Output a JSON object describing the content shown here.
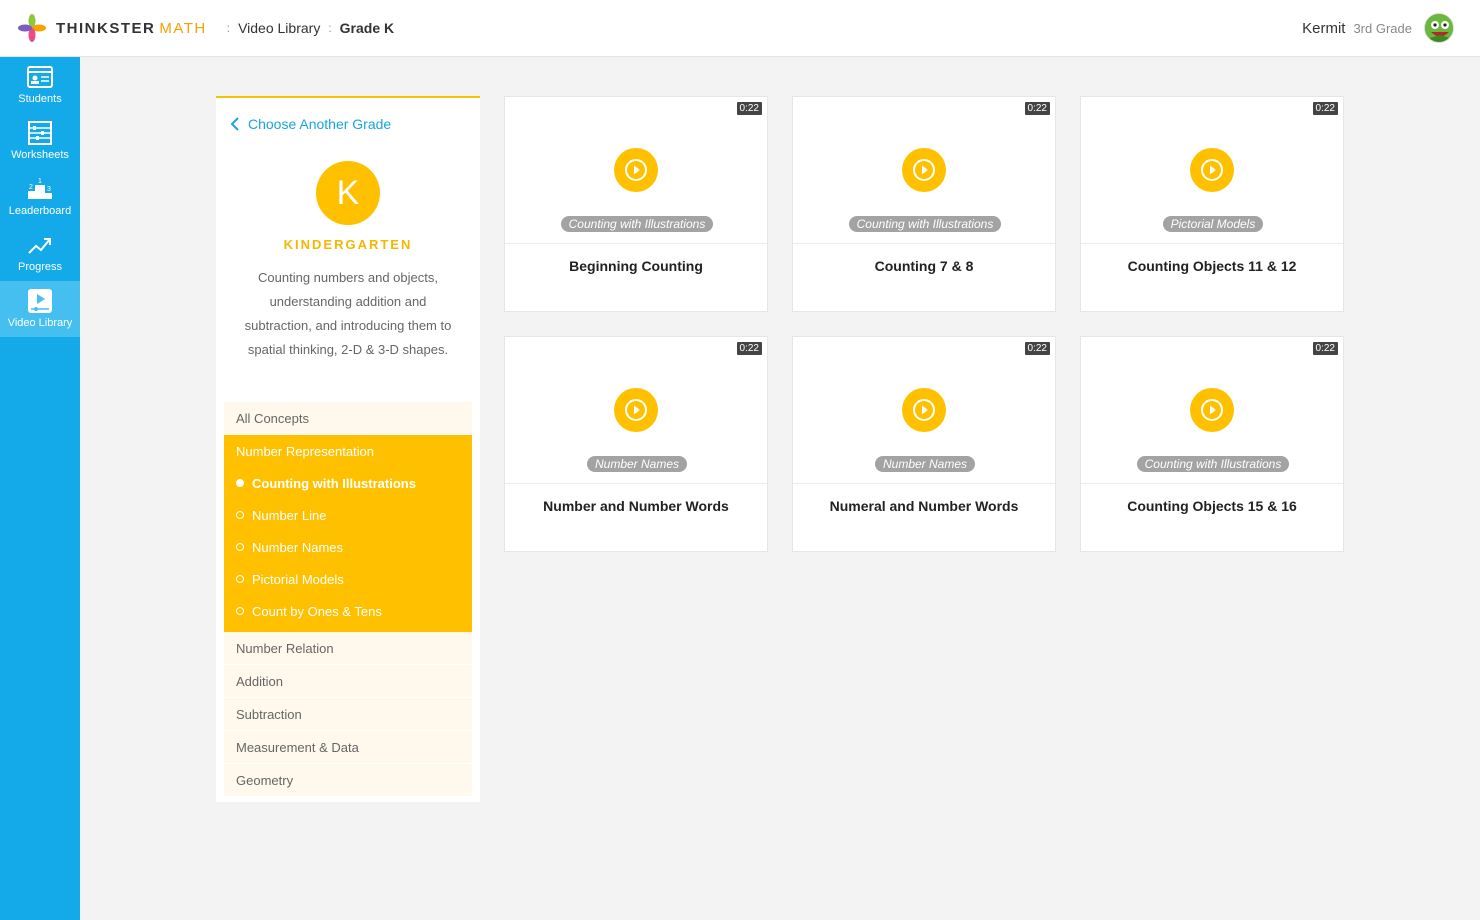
{
  "header": {
    "logo_brand": "THINKSTER",
    "logo_accent": "MATH",
    "breadcrumbs": [
      "Video Library",
      "Grade K"
    ],
    "user_name": "Kermit",
    "user_grade": "3rd Grade"
  },
  "sidebar": {
    "items": [
      {
        "label": "Students",
        "icon": "students-icon",
        "active": false
      },
      {
        "label": "Worksheets",
        "icon": "abacus-icon",
        "active": false
      },
      {
        "label": "Leaderboard",
        "icon": "podium-icon",
        "active": false
      },
      {
        "label": "Progress",
        "icon": "trend-icon",
        "active": false
      },
      {
        "label": "Video Library",
        "icon": "video-icon",
        "active": true
      }
    ]
  },
  "panel": {
    "back_label": "Choose Another Grade",
    "grade_letter": "K",
    "grade_name": "KINDERGARTEN",
    "description": "Counting numbers and objects, understanding addition and subtraction, and introducing them to spatial thinking, 2-D & 3-D shapes.",
    "all_concepts": "All Concepts",
    "active_group": "Number Representation",
    "subconcepts": [
      {
        "label": "Counting with Illustrations",
        "active": true
      },
      {
        "label": "Number Line",
        "active": false
      },
      {
        "label": "Number Names",
        "active": false
      },
      {
        "label": "Pictorial Models",
        "active": false
      },
      {
        "label": "Count by Ones & Tens",
        "active": false
      }
    ],
    "other_concepts": [
      "Number Relation",
      "Addition",
      "Subtraction",
      "Measurement & Data",
      "Geometry"
    ]
  },
  "videos": [
    {
      "title": "Beginning Counting",
      "tag": "Counting with Illustrations",
      "duration": "0:22"
    },
    {
      "title": "Counting 7 & 8",
      "tag": "Counting with Illustrations",
      "duration": "0:22"
    },
    {
      "title": "Counting Objects 11 & 12",
      "tag": "Pictorial Models",
      "duration": "0:22"
    },
    {
      "title": "Number and Number Words",
      "tag": "Number Names",
      "duration": "0:22"
    },
    {
      "title": "Numeral and Number Words",
      "tag": "Number Names",
      "duration": "0:22"
    },
    {
      "title": "Counting Objects 15 & 16",
      "tag": "Counting with Illustrations",
      "duration": "0:22"
    }
  ],
  "colors": {
    "nav_blue": "#14a9e8",
    "accent_yellow": "#ffc000",
    "link_blue": "#19a5e0"
  }
}
